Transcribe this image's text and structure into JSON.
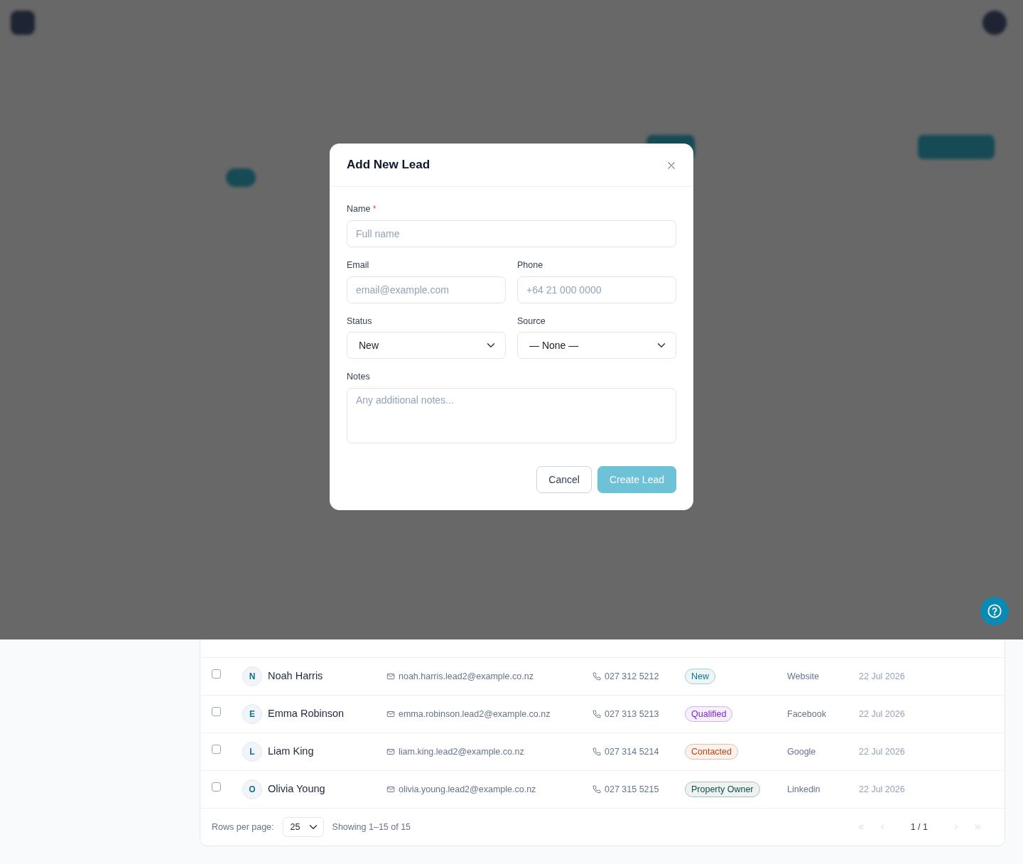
{
  "modal": {
    "title": "Add New Lead",
    "rows": [
      [
        {
          "kind": "input",
          "label": "Name",
          "required_mark": "*",
          "placeholder": "Full name"
        }
      ],
      [
        {
          "kind": "input",
          "label": "Email",
          "placeholder": "email@example.com"
        },
        {
          "kind": "input",
          "label": "Phone",
          "placeholder": "+64 21 000 0000"
        }
      ],
      [
        {
          "kind": "select",
          "label": "Status",
          "value": "New"
        },
        {
          "kind": "select",
          "label": "Source",
          "value": "— None —"
        }
      ],
      [
        {
          "kind": "textarea",
          "label": "Notes",
          "placeholder": "Any additional notes..."
        }
      ]
    ],
    "buttons": [
      {
        "label": "Cancel",
        "kind": "secondary",
        "disabled": false
      },
      {
        "label": "Create Lead",
        "kind": "primary",
        "disabled": true
      }
    ]
  },
  "table": {
    "rows": [
      {
        "checked": false,
        "initial": "N",
        "name": "Noah Harris",
        "email": "noah.harris.lead2@example.co.nz",
        "phone": "027 312 5212",
        "status": {
          "label": "New",
          "color": "#0e7490"
        },
        "source": "Website",
        "created": "22 Jul 2026"
      },
      {
        "checked": false,
        "initial": "E",
        "name": "Emma Robinson",
        "email": "emma.robinson.lead2@example.co.nz",
        "phone": "027 313 5213",
        "status": {
          "label": "Qualified",
          "color": "#7e22ce"
        },
        "source": "Facebook",
        "created": "22 Jul 2026"
      },
      {
        "checked": false,
        "initial": "L",
        "name": "Liam King",
        "email": "liam.king.lead2@example.co.nz",
        "phone": "027 314 5214",
        "status": {
          "label": "Contacted",
          "color": "#c2410c"
        },
        "source": "Google",
        "created": "22 Jul 2026"
      },
      {
        "checked": false,
        "initial": "O",
        "name": "Olivia Young",
        "email": "olivia.young.lead2@example.co.nz",
        "phone": "027 315 5215",
        "status": {
          "label": "Property Owner",
          "color": "#134e4a"
        },
        "source": "Linkedin",
        "created": "22 Jul 2026"
      }
    ],
    "footer": {
      "rows_per_page_label": "Rows per page:",
      "rows_per_page": "25",
      "showing": "Showing 1–15 of 15",
      "page": "1 / 1"
    }
  }
}
